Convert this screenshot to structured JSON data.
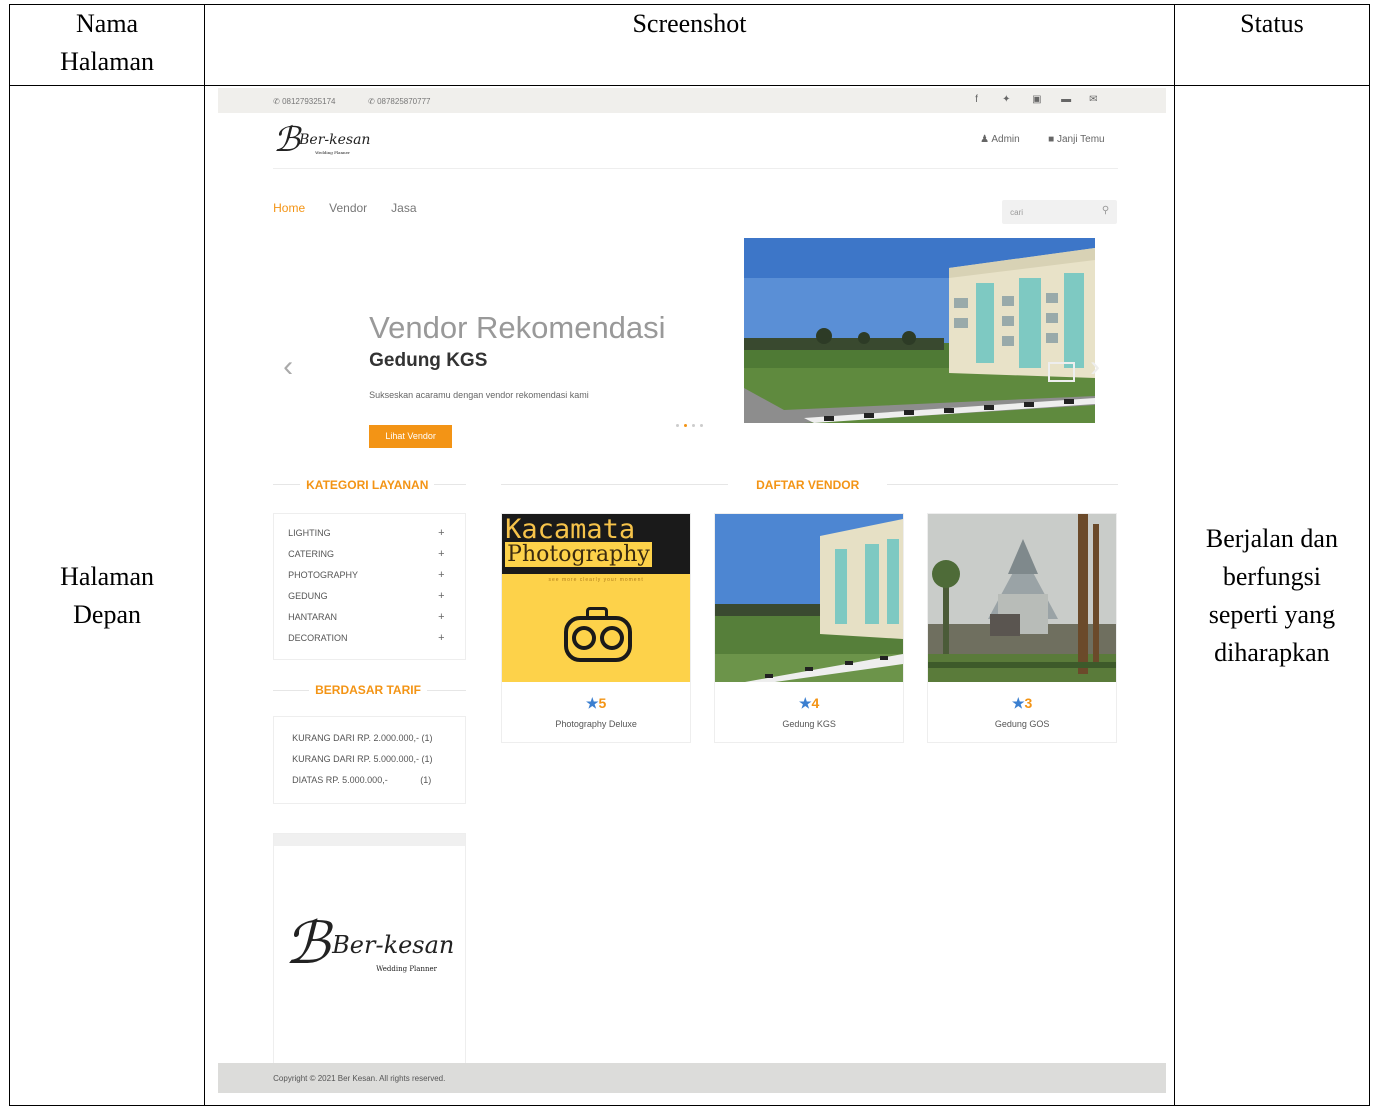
{
  "table": {
    "headers": [
      "Nama\nHalaman",
      "Screenshot",
      "Status"
    ],
    "page_name": [
      "Halaman",
      "Depan"
    ],
    "status": [
      "Berjalan dan",
      "berfungsi",
      "seperti yang",
      "diharapkan"
    ]
  },
  "site": {
    "phones": [
      "081279325174",
      "087825870777"
    ],
    "logo_script": "Ber-kesan",
    "logo_sub": "Wedding Planner",
    "header_links": [
      "Admin",
      "Janji Temu"
    ],
    "nav": [
      "Home",
      "Vendor",
      "Jasa"
    ],
    "search_placeholder": "cari",
    "slider": {
      "title": "Vendor Rekomendasi",
      "subtitle": "Gedung KGS",
      "desc": "Sukseskan acaramu dengan vendor rekomendasi kami",
      "button": "Lihat Vendor"
    },
    "kategori_title": "KATEGORI LAYANAN",
    "kategori": [
      "LIGHTING",
      "CATERING",
      "PHOTOGRAPHY",
      "GEDUNG",
      "HANTARAN",
      "DECORATION"
    ],
    "tarif_title": "BERDASAR TARIF",
    "tarif": [
      {
        "label": "KURANG DARI RP. 2.000.000,-",
        "count": "(1)"
      },
      {
        "label": "KURANG DARI RP. 5.000.000,-",
        "count": "(1)"
      },
      {
        "label": "DIATAS RP. 5.000.000,-",
        "count": "(1)"
      }
    ],
    "vendor_title": "DAFTAR VENDOR",
    "vendors": [
      {
        "rating": "5",
        "name": "Photography Deluxe",
        "img_line1": "Kacamata",
        "img_line2": "Photography",
        "img_tag": "see more clearly your moment"
      },
      {
        "rating": "4",
        "name": "Gedung KGS"
      },
      {
        "rating": "3",
        "name": "Gedung GOS"
      }
    ],
    "footer": "Copyright © 2021 Ber Kesan. All rights reserved.",
    "colors": {
      "accent": "#f39415",
      "star": "#3b7fd0"
    }
  }
}
